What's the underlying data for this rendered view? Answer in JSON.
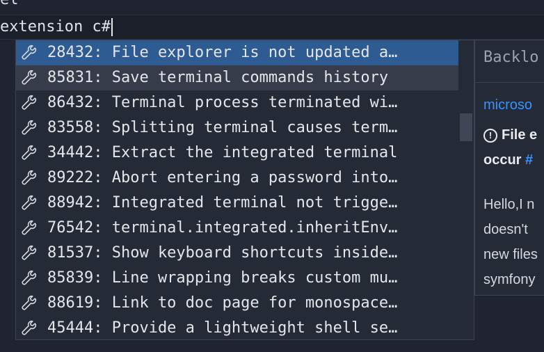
{
  "editor": {
    "previous_line": "el",
    "input_value": "extension c#"
  },
  "suggestions": [
    {
      "label": "28432: File explorer is not updated a…",
      "state": "selected"
    },
    {
      "label": "85831: Save terminal commands history",
      "state": "hover"
    },
    {
      "label": "86432: Terminal process terminated wi…",
      "state": "normal"
    },
    {
      "label": "83558: Splitting terminal causes term…",
      "state": "normal"
    },
    {
      "label": "34442: Extract the integrated terminal",
      "state": "normal"
    },
    {
      "label": "89222: Abort entering a password into…",
      "state": "normal"
    },
    {
      "label": "88942: Integrated terminal not trigge…",
      "state": "normal"
    },
    {
      "label": "76542: terminal.integrated.inheritEnv…",
      "state": "normal"
    },
    {
      "label": "81537: Show keyboard shortcuts inside…",
      "state": "normal"
    },
    {
      "label": "85839: Line wrapping breaks custom mu…",
      "state": "normal"
    },
    {
      "label": "88619: Link to doc page for monospace…",
      "state": "normal"
    },
    {
      "label": "45444: Provide a lightweight shell se…",
      "state": "normal"
    }
  ],
  "detail": {
    "title": "Backlo",
    "repo": "microso",
    "issue_title_line1": "File e",
    "issue_title_line2_text": "occur ",
    "issue_title_line2_link": "#",
    "body_lines": [
      "Hello,I n",
      "doesn't",
      "new files",
      "symfony"
    ]
  },
  "colors": {
    "selected": "#2f5b93",
    "hover": "#363c49",
    "link": "#3794ff"
  },
  "icons": {
    "suggestion": "wrench-icon",
    "issue": "issue-opened-icon"
  }
}
